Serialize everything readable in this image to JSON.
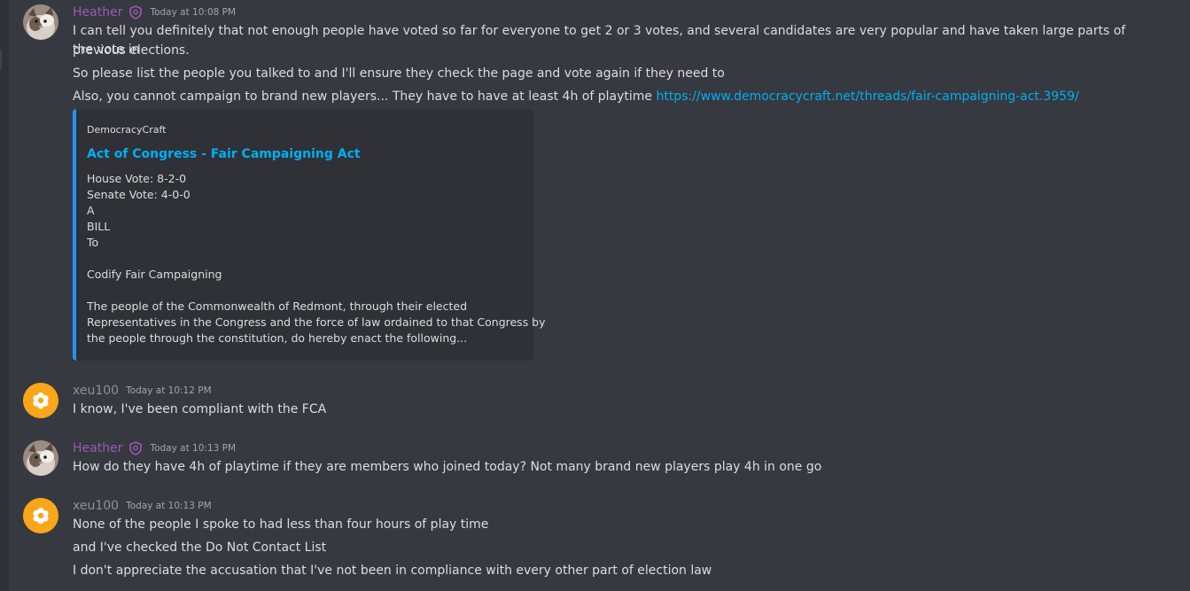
{
  "messages": [
    {
      "author": "Heather",
      "author_color": "#9b59b6",
      "badge": "shield-icon",
      "timestamp": "Today at 10:08 PM",
      "lines": [
        "I can tell you definitely that not enough people have voted so far for everyone to get 2 or 3 votes, and several candidates are very popular and have taken large parts of the vote in",
        "previous elections.",
        "So please list the people you talked to and I'll ensure they check the page and vote again if they need to",
        "Also, you cannot campaign to brand new players... They have to have at least 4h of playtime "
      ],
      "link": "https://www.democracycraft.net/threads/fair-campaigning-act.3959/",
      "embed": {
        "provider": "DemocracyCraft",
        "title": "Act of Congress - Fair Campaigning Act",
        "accent_color": "#2196f3",
        "description_lines": [
          "House Vote: 8-2-0",
          "Senate Vote: 4-0-0",
          "A",
          "BILL",
          "To",
          "",
          "Codify Fair Campaigning",
          "",
          "The people of the Commonwealth of Redmont, through their elected",
          "Representatives in the Congress and the force of law ordained to that Congress by",
          "the people through the constitution, do hereby enact the following..."
        ]
      }
    },
    {
      "author": "xeu100",
      "author_color": "#8e9297",
      "timestamp": "Today at 10:12 PM",
      "lines": [
        "I know, I've been compliant with the FCA"
      ]
    },
    {
      "author": "Heather",
      "author_color": "#9b59b6",
      "badge": "shield-icon",
      "timestamp": "Today at 10:13 PM",
      "lines": [
        "How do they have 4h of playtime if they are members who joined today? Not many brand new players play 4h in one go"
      ]
    },
    {
      "author": "xeu100",
      "author_color": "#8e9297",
      "timestamp": "Today at 10:13 PM",
      "lines": [
        "None of the people I spoke to had less than four hours of play time",
        "and I've checked the Do Not Contact List",
        "I don't appreciate the accusation that I've not been in compliance with every other part of election law"
      ]
    }
  ],
  "colors": {
    "background": "#36393f",
    "text": "#dcddde",
    "link": "#00aff4",
    "timestamp": "#a3a6aa",
    "xeu_avatar_bg": "#faa61a"
  }
}
